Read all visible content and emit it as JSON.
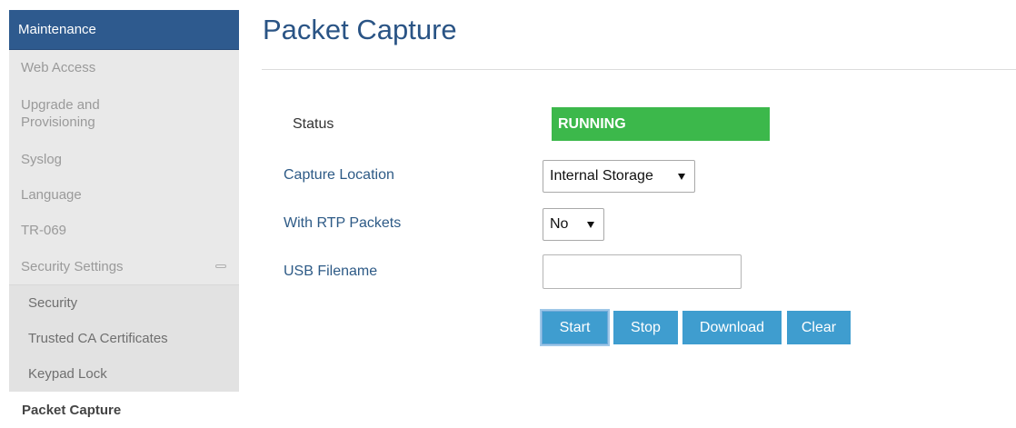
{
  "sidebar": {
    "header": "Maintenance",
    "items": [
      {
        "label": "Web Access"
      },
      {
        "label": "Upgrade and Provisioning"
      },
      {
        "label": "Syslog"
      },
      {
        "label": "Language"
      },
      {
        "label": "TR-069"
      },
      {
        "label": "Security Settings",
        "icon": "collapse-icon"
      }
    ],
    "sub_items": [
      {
        "label": "Security"
      },
      {
        "label": "Trusted CA Certificates"
      },
      {
        "label": "Keypad Lock"
      }
    ],
    "current": "Packet Capture"
  },
  "main": {
    "title": "Packet Capture",
    "status": {
      "label": "Status",
      "value": "RUNNING",
      "color": "#3cb84b"
    },
    "capture_location": {
      "label": "Capture Location",
      "value": "Internal Storage"
    },
    "rtp_packets": {
      "label": "With RTP Packets",
      "value": "No"
    },
    "usb_filename": {
      "label": "USB Filename",
      "value": "",
      "placeholder": ""
    },
    "buttons": {
      "start": "Start",
      "stop": "Stop",
      "download": "Download",
      "clear": "Clear"
    }
  },
  "colors": {
    "sidebar_header": "#2e5a8e",
    "title": "#2a5485",
    "button": "#3f9dcf",
    "status_running": "#3cb84b"
  }
}
